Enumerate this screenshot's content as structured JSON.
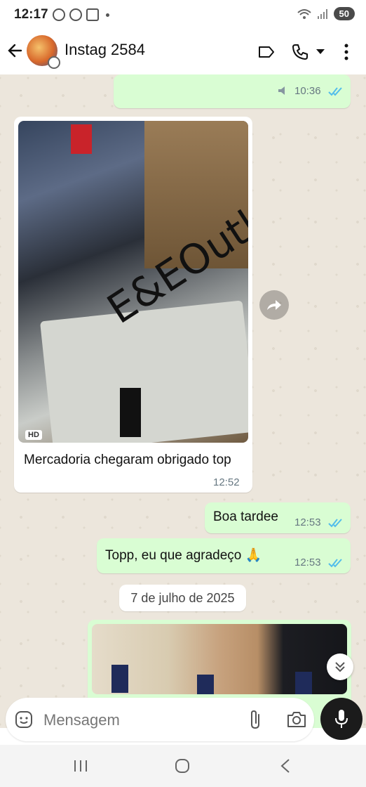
{
  "status_bar": {
    "time": "12:17",
    "battery": "50"
  },
  "header": {
    "contact_name": "Instag 2584"
  },
  "messages": [
    {
      "direction": "out",
      "time": "10:36"
    },
    {
      "direction": "in",
      "image_watermark": "E&EOutlet",
      "image_badge": "HD",
      "text": "Mercadoria chegaram obrigado top",
      "time": "12:52"
    },
    {
      "direction": "out",
      "text": "Boa tardee",
      "time": "12:53"
    },
    {
      "direction": "out",
      "text": "Topp, eu que agradeço 🙏",
      "time": "12:53"
    }
  ],
  "date_divider": "7 de julho de 2025",
  "composer": {
    "placeholder": "Mensagem"
  },
  "colors": {
    "outgoing_bubble": "#d9fdd3",
    "incoming_bubble": "#ffffff",
    "read_ticks": "#53bdeb",
    "chat_bg": "#ece6dc"
  },
  "icons": [
    "back-arrow-icon",
    "label-icon",
    "phone-icon",
    "dropdown-icon",
    "more-vert-icon",
    "audio-icon",
    "double-check-icon",
    "forward-icon",
    "chevron-double-down-icon",
    "sticker-icon",
    "paperclip-icon",
    "camera-icon",
    "mic-icon",
    "recent-apps-icon",
    "home-icon",
    "back-nav-icon"
  ]
}
